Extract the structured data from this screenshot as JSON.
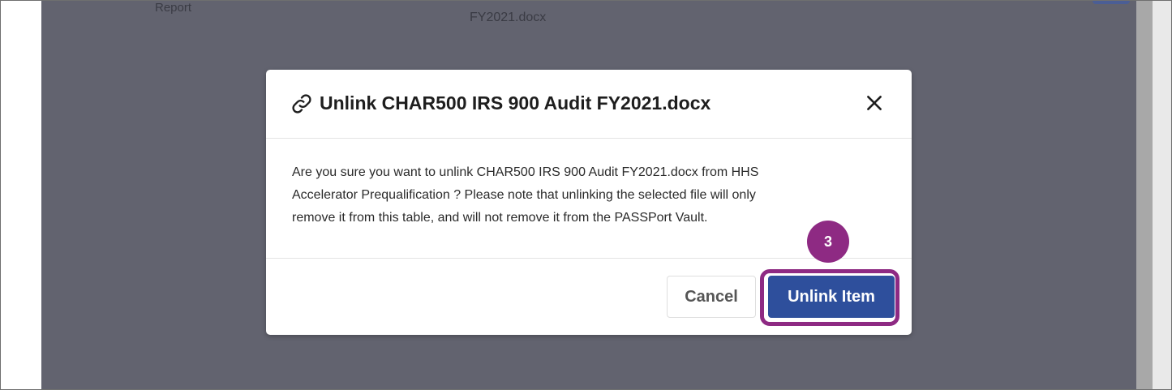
{
  "background": {
    "row_label": "Report",
    "file_name": "FY2021.docx",
    "dropdown_arrow": "▼"
  },
  "dialog": {
    "icon": "link-icon",
    "title": "Unlink CHAR500 IRS 900 Audit FY2021.docx",
    "close_icon": "close-icon",
    "body_lines": [
      "Are you sure you want to unlink CHAR500 IRS 900 Audit FY2021.docx from HHS",
      "Accelerator Prequalification ? Please note that unlinking the selected file will only",
      "remove it from this table, and will not remove it from the PASSPort Vault."
    ],
    "cancel_label": "Cancel",
    "confirm_label": "Unlink Item"
  },
  "annotation": {
    "step_number": "3",
    "color": "#8e2a83"
  },
  "colors": {
    "overlay": "#62636f",
    "primary_button": "#2e4f9c"
  }
}
